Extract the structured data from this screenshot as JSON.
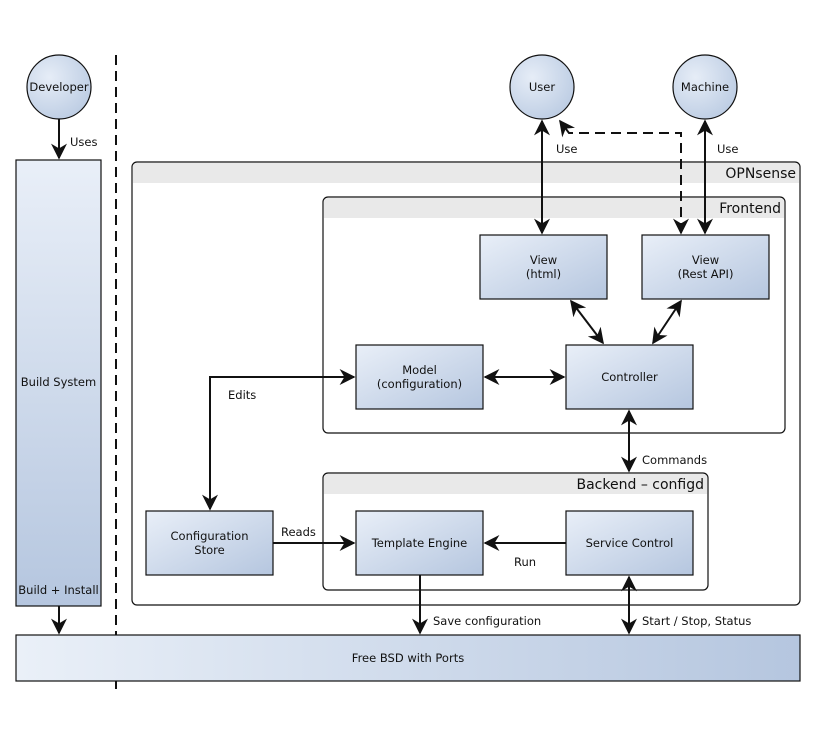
{
  "diagram": {
    "actors": {
      "developer": "Developer",
      "user": "User",
      "machine": "Machine"
    },
    "containers": {
      "opnsense": "OPNsense",
      "frontend": "Frontend",
      "backend": "Backend – configd"
    },
    "nodes": {
      "build_system": "Build System",
      "build_install": "Build + Install",
      "view_html": [
        "View",
        "(html)"
      ],
      "view_rest": [
        "View",
        "(Rest API)"
      ],
      "model": [
        "Model",
        "(configuration)"
      ],
      "controller": "Controller",
      "config_store": [
        "Configuration",
        "Store"
      ],
      "template_engine": "Template Engine",
      "service_control": "Service Control",
      "freebsd": "Free BSD with Ports"
    },
    "edge_labels": {
      "uses": "Uses",
      "use_user": "Use",
      "use_machine": "Use",
      "edits": "Edits",
      "commands": "Commands",
      "reads": "Reads",
      "run": "Run",
      "save_configuration": "Save configuration",
      "start_stop_status": "Start / Stop, Status"
    },
    "colors": {
      "node_fill_start": "#e8eef7",
      "node_fill_end": "#b6c7e0",
      "container_header": "#e9e9e9",
      "stroke": "#111111"
    }
  }
}
